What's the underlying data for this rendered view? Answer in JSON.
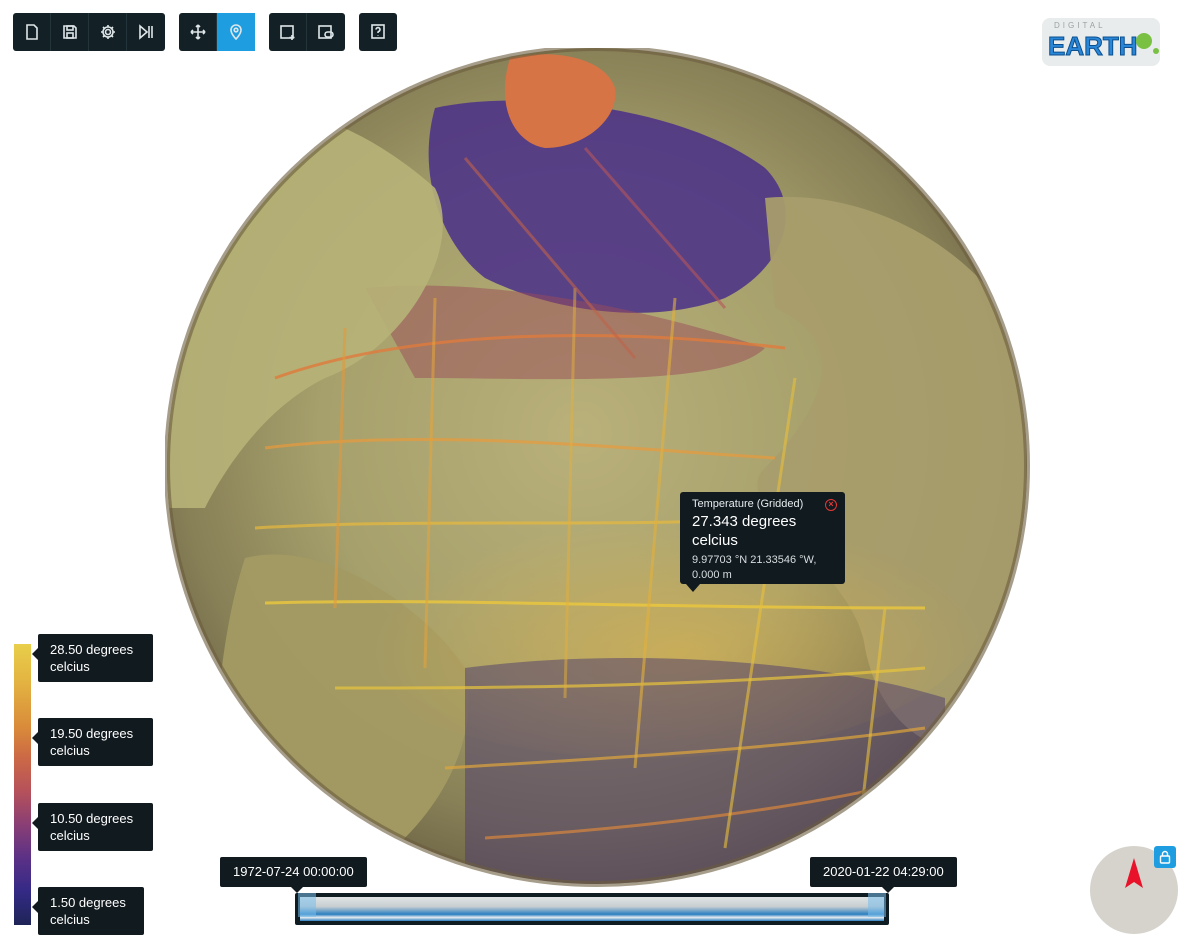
{
  "toolbar": {
    "file_tools": [
      {
        "icon": "new-document-icon",
        "label": "New"
      },
      {
        "icon": "save-icon",
        "label": "Save"
      },
      {
        "icon": "settings-gear-icon",
        "label": "Settings"
      },
      {
        "icon": "play-pause-icon",
        "label": "Play"
      }
    ],
    "navigation_tools": [
      {
        "icon": "pan-move-icon",
        "label": "Move",
        "active": false
      },
      {
        "icon": "location-pin-icon",
        "label": "Pick location",
        "active": true
      }
    ],
    "layer_tools": [
      {
        "icon": "add-layer-icon",
        "label": "Add layer"
      },
      {
        "icon": "layer-settings-icon",
        "label": "Layer settings"
      }
    ],
    "help_tools": [
      {
        "icon": "help-icon",
        "label": "Help"
      }
    ],
    "active_color": "#1e9ee0",
    "background_color": "#132127"
  },
  "logo": {
    "top_text": "DIGITAL",
    "main_text": "EARTH"
  },
  "tooltip": {
    "title": "Temperature (Gridded)",
    "value_line1": "27.343 degrees",
    "value_line2": "celcius",
    "coords": "9.97703 °N 21.33546 °W,",
    "depth": "0.000 m"
  },
  "legend": {
    "entries": [
      {
        "line1": "28.50 degrees",
        "line2": "celcius"
      },
      {
        "line1": "19.50 degrees",
        "line2": "celcius"
      },
      {
        "line1": "10.50 degrees",
        "line2": "celcius"
      },
      {
        "line1": "1.50 degrees",
        "line2": "celcius"
      }
    ],
    "colors": [
      "#e8cf4a",
      "#d98a3a",
      "#b7525a",
      "#5c3186",
      "#1e2456"
    ]
  },
  "timeline": {
    "start": "1972-07-24 00:00:00",
    "end": "2020-01-22 04:29:00"
  },
  "compass": {
    "needle_color": "#e8132b",
    "lock_color": "#1e9ee0"
  }
}
